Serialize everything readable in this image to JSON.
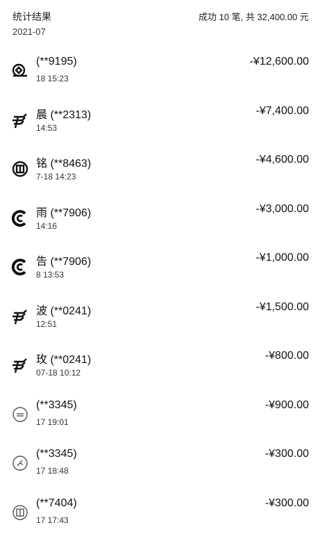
{
  "header": {
    "title": "统计结果",
    "summary": "成功 10 笔, 共 32,400.00 元",
    "month": "2021-07"
  },
  "transactions": [
    {
      "name": "(**9195)",
      "time": "18 15:23",
      "amount": "-¥12,600.00",
      "icon": "bank-logo-icon"
    },
    {
      "name": "晨 (**2313)",
      "time": "14:53",
      "amount": "-¥7,400.00",
      "icon": "postal-bank-icon"
    },
    {
      "name": "铭 (**8463)",
      "time": "7-18 14:23",
      "amount": "-¥4,600.00",
      "icon": "icbc-bank-icon"
    },
    {
      "name": "雨 (**7906)",
      "time": "14:16",
      "amount": "-¥3,000.00",
      "icon": "ccb-bank-icon"
    },
    {
      "name": "告 (**7906)",
      "time": "8 13:53",
      "amount": "-¥1,000.00",
      "icon": "ccb-bank-icon"
    },
    {
      "name": "波 (**0241)",
      "time": "12:51",
      "amount": "-¥1,500.00",
      "icon": "postal-bank-icon"
    },
    {
      "name": "玫 (**0241)",
      "time": "07-18 10:12",
      "amount": "-¥800.00",
      "icon": "postal-bank-icon"
    },
    {
      "name": "(**3345)",
      "time": "17 19:01",
      "amount": "-¥900.00",
      "icon": "bank-generic-icon"
    },
    {
      "name": "(**3345)",
      "time": "17 18:48",
      "amount": "-¥300.00",
      "icon": "bank-generic-icon"
    },
    {
      "name": "(**7404)",
      "time": "17 17:43",
      "amount": "-¥300.00",
      "icon": "icbc-bank-icon"
    }
  ]
}
